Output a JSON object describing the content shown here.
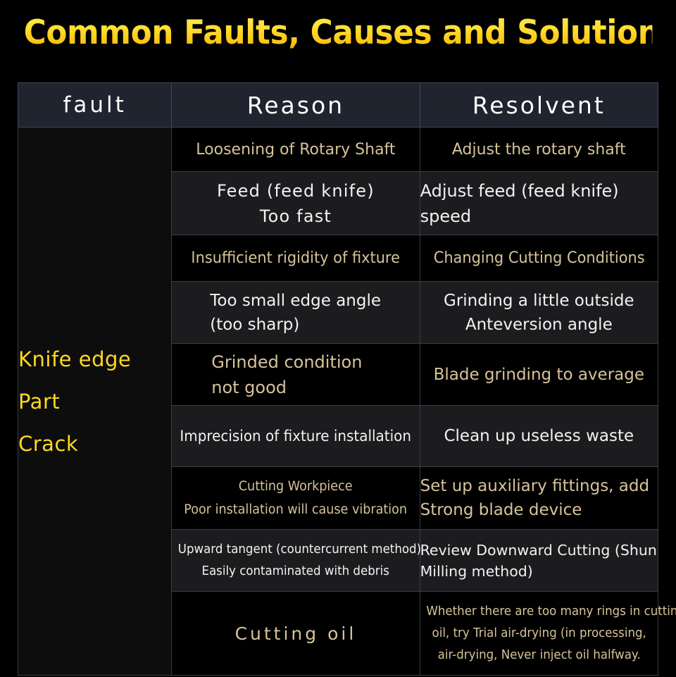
{
  "title": "Common Faults, Causes and Solutions",
  "colors": {
    "title_gradient_top": "#ffe95c",
    "title_gradient_bottom": "#e09a05",
    "fault_text": "#ffd91e",
    "header_bg": "#20242f",
    "header_text": "#ffffff",
    "dark_row_text": "#d6c39a",
    "light_row_text": "#f2f2f2",
    "grid_line": "#3a3d46",
    "page_bg": "#000000"
  },
  "table": {
    "headers": {
      "fault": "fault",
      "reason": "Reason",
      "resolvent": "Resolvent"
    },
    "fault_label_lines": [
      "Knife edge",
      "Part",
      "Crack"
    ],
    "rows": [
      {
        "style": "dark",
        "reason": [
          "Loosening of Rotary Shaft"
        ],
        "resolvent": [
          "Adjust the rotary shaft"
        ]
      },
      {
        "style": "light",
        "reason": [
          "Feed (feed knife)",
          "Too fast"
        ],
        "resolvent": [
          "Adjust feed (feed knife)",
          "speed"
        ]
      },
      {
        "style": "dark",
        "reason": [
          "Insufficient rigidity of fixture"
        ],
        "resolvent": [
          "Changing Cutting Conditions"
        ]
      },
      {
        "style": "light",
        "reason": [
          "Too small edge angle",
          "(too sharp)"
        ],
        "resolvent": [
          "Grinding a little outside",
          "Anteversion angle"
        ]
      },
      {
        "style": "dark",
        "reason": [
          "Grinded condition",
          "not good"
        ],
        "resolvent": [
          "Blade grinding to average"
        ]
      },
      {
        "style": "light",
        "reason": [
          "Imprecision of fixture installation"
        ],
        "resolvent": [
          "Clean up useless waste"
        ]
      },
      {
        "style": "dark",
        "reason": [
          "Cutting Workpiece",
          "Poor installation will cause vibration"
        ],
        "resolvent": [
          "Set up auxiliary fittings, add",
          "Strong blade device"
        ]
      },
      {
        "style": "light",
        "reason": [
          "Upward tangent (countercurrent method)",
          "Easily contaminated with debris"
        ],
        "resolvent": [
          "Review Downward Cutting (Shun",
          "Milling method)"
        ]
      },
      {
        "style": "dark",
        "reason": [
          "Cutting oil"
        ],
        "resolvent": [
          "Whether there are too many rings in cutting",
          "oil, try Trial air-drying (in processing,",
          "air-drying, Never inject oil halfway."
        ]
      }
    ]
  }
}
